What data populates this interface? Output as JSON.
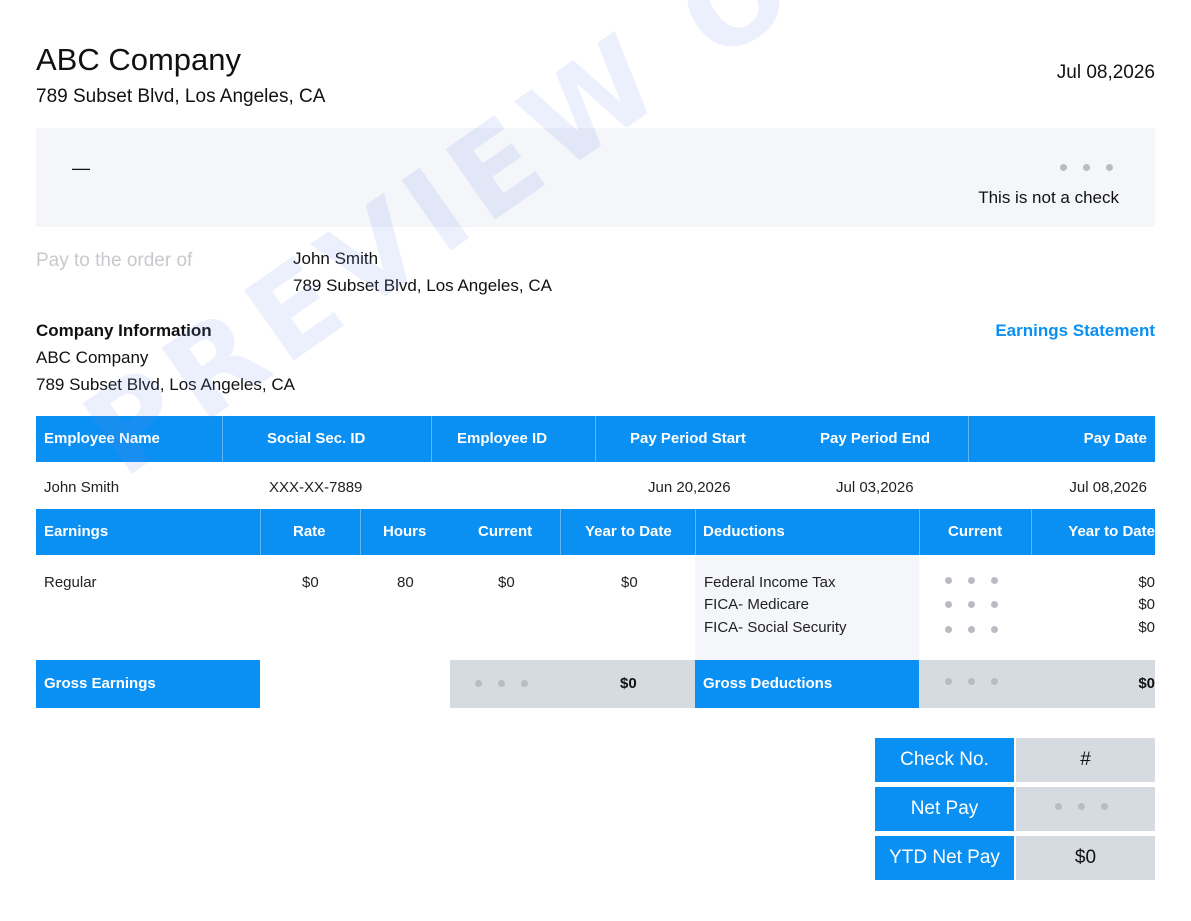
{
  "header": {
    "company_name": "ABC Company",
    "company_address": "789 Subset Blvd, Los Angeles, CA",
    "date": "Jul 08,2026"
  },
  "check_band": {
    "dash": "—",
    "notice": "This is not a check"
  },
  "payee": {
    "label": "Pay to the order of",
    "name": "John Smith",
    "address": "789 Subset Blvd, Los Angeles, CA"
  },
  "company_info": {
    "heading": "Company Information",
    "name": "ABC Company",
    "address": "789 Subset Blvd, Los Angeles, CA",
    "statement_title": "Earnings Statement"
  },
  "employee_table": {
    "headers": [
      "Employee Name",
      "Social Sec. ID",
      "Employee ID",
      "Pay Period Start",
      "Pay Period End",
      "Pay Date"
    ],
    "row": [
      "John Smith",
      "XXX-XX-7889",
      "",
      "Jun 20,2026",
      "Jul 03,2026",
      "Jul 08,2026"
    ]
  },
  "earnings_table": {
    "headers": [
      "Earnings",
      "Rate",
      "Hours",
      "Current",
      "Year to Date"
    ],
    "rows": [
      {
        "name": "Regular",
        "rate": "$0",
        "hours": "80",
        "current": "$0",
        "ytd": "$0"
      }
    ],
    "gross_label": "Gross Earnings",
    "gross_ytd": "$0"
  },
  "deductions_table": {
    "headers": [
      "Deductions",
      "Current",
      "Year to Date"
    ],
    "rows": [
      {
        "name": "Federal Income Tax",
        "ytd": "$0"
      },
      {
        "name": "FICA- Medicare",
        "ytd": "$0"
      },
      {
        "name": "FICA- Social Security",
        "ytd": "$0"
      }
    ],
    "gross_label": "Gross Deductions",
    "gross_ytd": "$0"
  },
  "summary": {
    "check_no_label": "Check No.",
    "check_no_value": "#",
    "net_pay_label": "Net Pay",
    "ytd_net_pay_label": "YTD Net Pay",
    "ytd_net_pay_value": "$0"
  },
  "watermark": "PREVIEW ONLY",
  "colors": {
    "accent": "#0a8ff3",
    "band": "#f4f6fa",
    "gray_cell": "#d6dae1"
  }
}
